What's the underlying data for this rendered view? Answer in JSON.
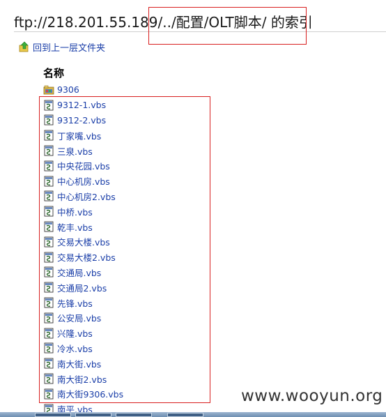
{
  "title": "ftp://218.201.55.189/../配置/OLT脚本/ 的索引",
  "up_link": "回到上一层文件夹",
  "column_header": "名称",
  "folder": {
    "name": "9306",
    "icon": "folder-icon"
  },
  "files": [
    "9312-1.vbs",
    "9312-2.vbs",
    "丁家嘴.vbs",
    "三泉.vbs",
    "中央花园.vbs",
    "中心机房.vbs",
    "中心机房2.vbs",
    "中桥.vbs",
    "乾丰.vbs",
    "交易大楼.vbs",
    "交易大楼2.vbs",
    "交通局.vbs",
    "交通局2.vbs",
    "先锋.vbs",
    "公安局.vbs",
    "兴隆.vbs",
    "冷水.vbs",
    "南大街.vbs",
    "南大街2.vbs",
    "南大街9306.vbs",
    "南平.vbs"
  ],
  "file_icon": "script-file-icon",
  "highlight_color": "#d81e1e",
  "link_color": "#1a3ea8",
  "watermark": "www.wooyun.org"
}
